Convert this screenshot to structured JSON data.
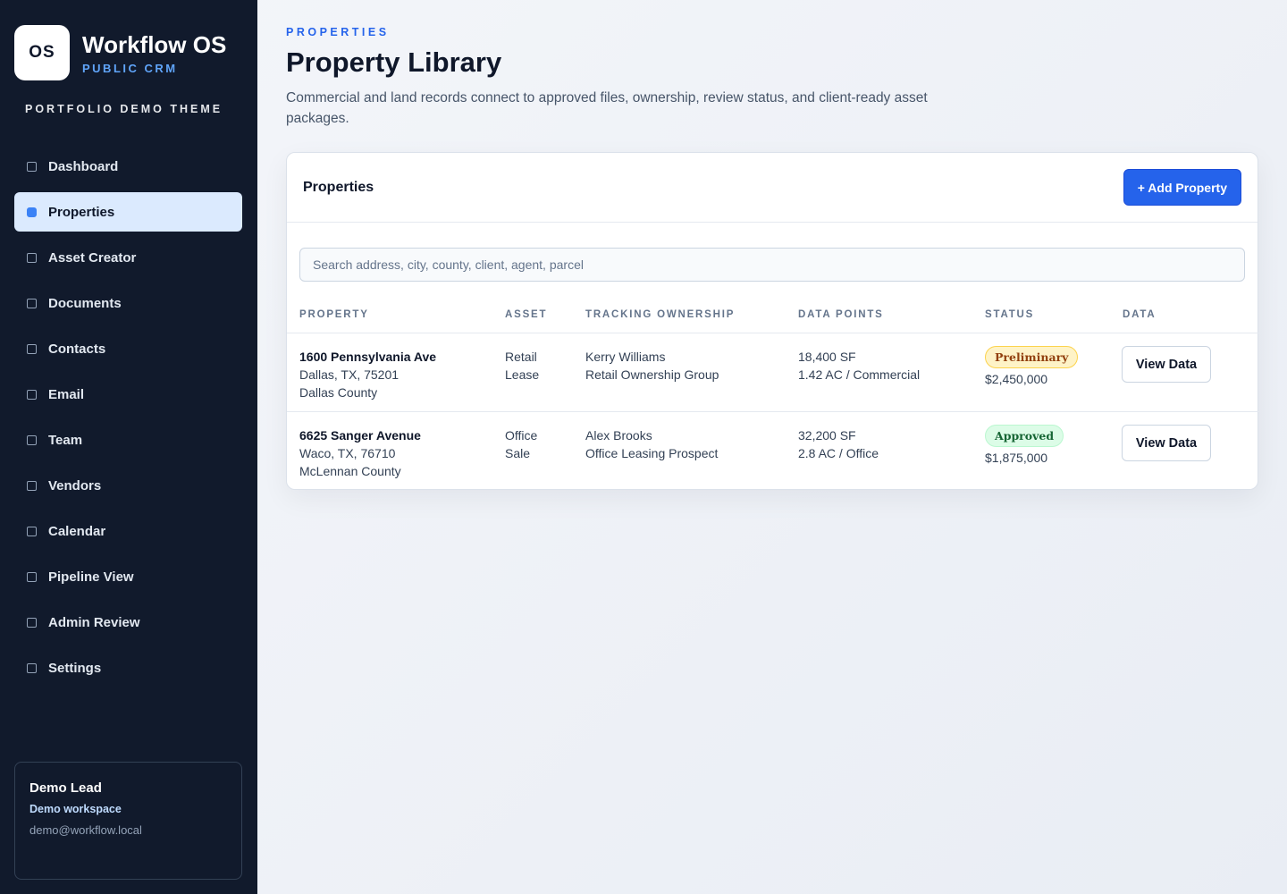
{
  "sidebar": {
    "logo_text": "OS",
    "brand_title": "Workflow OS",
    "brand_subtitle": "PUBLIC CRM",
    "theme_label": "PORTFOLIO DEMO THEME",
    "items": [
      {
        "label": "Dashboard",
        "active": false
      },
      {
        "label": "Properties",
        "active": true
      },
      {
        "label": "Asset Creator",
        "active": false
      },
      {
        "label": "Documents",
        "active": false
      },
      {
        "label": "Contacts",
        "active": false
      },
      {
        "label": "Email",
        "active": false
      },
      {
        "label": "Team",
        "active": false
      },
      {
        "label": "Vendors",
        "active": false
      },
      {
        "label": "Calendar",
        "active": false
      },
      {
        "label": "Pipeline View",
        "active": false
      },
      {
        "label": "Admin Review",
        "active": false
      },
      {
        "label": "Settings",
        "active": false
      }
    ],
    "user": {
      "name": "Demo Lead",
      "workspace": "Demo workspace",
      "email": "demo@workflow.local"
    }
  },
  "header": {
    "eyebrow": "PROPERTIES",
    "title": "Property Library",
    "description": "Commercial and land records connect to approved files, ownership, review status, and client-ready asset packages."
  },
  "card": {
    "title": "Properties",
    "add_button": "+ Add Property",
    "search_placeholder": "Search address, city, county, client, agent, parcel",
    "columns": [
      "PROPERTY",
      "ASSET",
      "TRACKING OWNERSHIP",
      "DATA POINTS",
      "STATUS",
      "DATA"
    ],
    "rows": [
      {
        "address": "1600 Pennsylvania Ave",
        "city": "Dallas, TX, 75201",
        "county": "Dallas County",
        "asset_type": "Retail",
        "asset_deal": "Lease",
        "owner": "Kerry Williams",
        "owner_group": "Retail Ownership Group",
        "size": "18,400 SF",
        "land": "1.42 AC / Commercial",
        "status": "Preliminary",
        "price": "$2,450,000",
        "action": "View Data"
      },
      {
        "address": "6625 Sanger Avenue",
        "city": "Waco, TX, 76710",
        "county": "McLennan County",
        "asset_type": "Office",
        "asset_deal": "Sale",
        "owner": "Alex Brooks",
        "owner_group": "Office Leasing Prospect",
        "size": "32,200 SF",
        "land": "2.8 AC / Office",
        "status": "Approved",
        "price": "$1,875,000",
        "action": "View Data"
      }
    ]
  },
  "colors": {
    "sidebar_bg": "#111a2c",
    "accent": "#2563eb",
    "active_nav_bg": "#dbeafe",
    "preliminary_badge": "#fef3c7",
    "approved_badge": "#dcfce7"
  }
}
